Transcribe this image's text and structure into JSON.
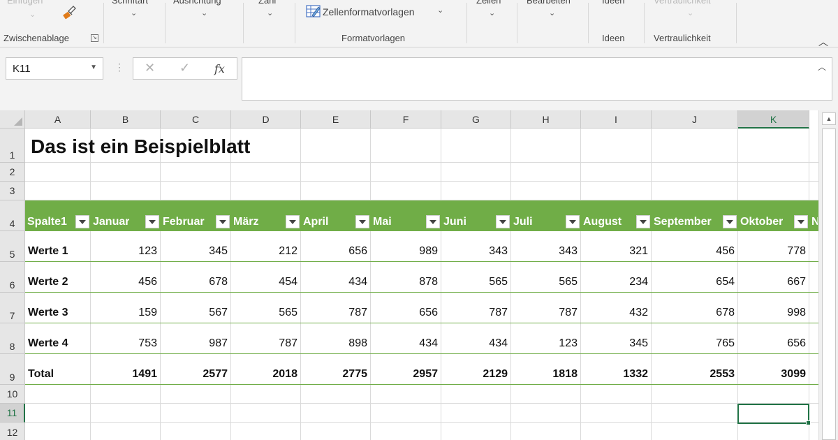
{
  "ribbon": {
    "einfuegen_label": "Einfügen",
    "schriftart_label": "Schriftart",
    "ausrichtung_label": "Ausrichtung",
    "zahl_label": "Zahl",
    "zellenformatvorlagen_label": "Zellenformatvorlagen",
    "zellen_label": "Zellen",
    "bearbeiten_label": "Bearbeiten",
    "ideen_button_label": "Ideen",
    "vertraulichkeit_button_label": "Vertraulichkeit",
    "groups": {
      "zwischenablage": "Zwischenablage",
      "formatvorlagen": "Formatvorlagen",
      "ideen": "Ideen",
      "vertraulichkeit": "Vertraulichkeit"
    }
  },
  "formula_bar": {
    "name_box": "K11",
    "formula": "",
    "fx_label": "fx"
  },
  "grid": {
    "columns": [
      "A",
      "B",
      "C",
      "D",
      "E",
      "F",
      "G",
      "H",
      "I",
      "J",
      "K"
    ],
    "rows": [
      "1",
      "2",
      "3",
      "4",
      "5",
      "6",
      "7",
      "8",
      "9",
      "10",
      "11",
      "12"
    ],
    "active_column": "K",
    "active_row": "11",
    "active_cell": "K11"
  },
  "sheet": {
    "title": "Das ist ein Beispielblatt",
    "table_headers": [
      "Spalte1",
      "Januar",
      "Februar",
      "März",
      "April",
      "Mai",
      "Juni",
      "Juli",
      "August",
      "September",
      "Oktober",
      "N"
    ],
    "rows": [
      {
        "label": "Werte 1",
        "values": [
          "123",
          "345",
          "212",
          "656",
          "989",
          "343",
          "343",
          "321",
          "456",
          "778"
        ]
      },
      {
        "label": "Werte 2",
        "values": [
          "456",
          "678",
          "454",
          "434",
          "878",
          "565",
          "565",
          "234",
          "654",
          "667"
        ]
      },
      {
        "label": "Werte 3",
        "values": [
          "159",
          "567",
          "565",
          "787",
          "656",
          "787",
          "787",
          "432",
          "678",
          "998"
        ]
      },
      {
        "label": "Werte 4",
        "values": [
          "753",
          "987",
          "787",
          "898",
          "434",
          "434",
          "123",
          "345",
          "765",
          "656"
        ]
      }
    ],
    "total": {
      "label": "Total",
      "values": [
        "1491",
        "2577",
        "2018",
        "2775",
        "2957",
        "2129",
        "1818",
        "1332",
        "2553",
        "3099"
      ]
    }
  },
  "colors": {
    "table_header": "#70ad47",
    "selection": "#217346"
  }
}
